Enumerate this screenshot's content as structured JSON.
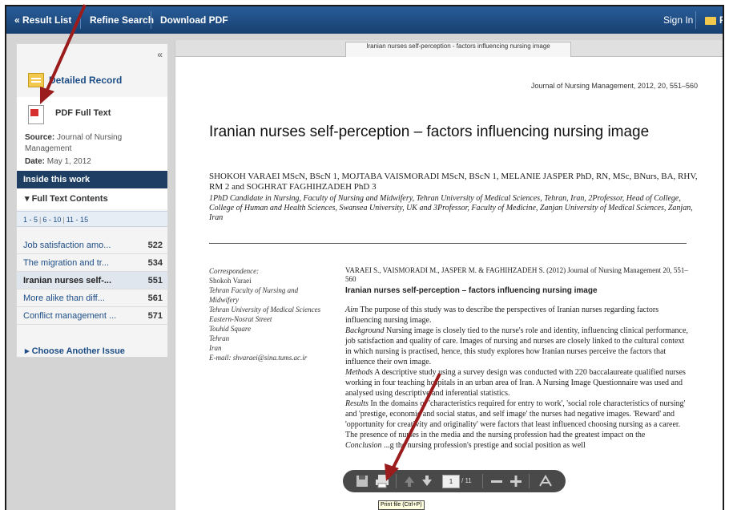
{
  "topbar": {
    "result_list": "« Result List",
    "refine_search": "Refine Search",
    "download_pdf": "Download PDF",
    "sign_in": "Sign In",
    "folder": "Fo"
  },
  "sidebar": {
    "collapse": "«",
    "detailed_record": "Detailed Record",
    "pdf_full_text": "PDF Full Text",
    "source_label": "Source:",
    "source_value": "Journal of Nursing Management",
    "date_label": "Date:",
    "date_value": "May 1, 2012",
    "inside_this_work": "Inside this work",
    "full_text_contents": "Full Text Contents",
    "pages": [
      "1 - 5",
      "6 - 10",
      "11 - 15"
    ],
    "toc": [
      {
        "title": "Job satisfaction amo...",
        "page": "522",
        "active": false
      },
      {
        "title": "The migration and tr...",
        "page": "534",
        "active": false
      },
      {
        "title": "Iranian nurses self-...",
        "page": "551",
        "active": true
      },
      {
        "title": "More alike than diff...",
        "page": "561",
        "active": false
      },
      {
        "title": "Conflict management ...",
        "page": "571",
        "active": false
      }
    ],
    "choose_another": "Choose Another Issue"
  },
  "document": {
    "tab_title": "Iranian nurses self-perception - factors influencing nursing image",
    "journal_ref": "Journal of Nursing Management, 2012, 20, 551–560",
    "title": "Iranian nurses self-perception – factors influencing nursing image",
    "authors": "SHOKOH VARAEI MScN, BScN 1, MOJTABA VAISMORADI MScN, BScN 1, MELANIE JASPER PhD, RN, MSc, BNurs, BA, RHV, RM 2 and SOGHRAT FAGHIHZADEH PhD 3",
    "affiliations": "1PhD Candidate in Nursing, Faculty of Nursing and Midwifery, Tehran University of Medical Sciences, Tehran, Iran, 2Professor, Head of College, College of Human and Health Sciences, Swansea University, UK and 3Professor, Faculty of Medicine, Zanjan University of Medical Sciences, Zanjan, Iran",
    "correspondence": [
      "Correspondence:",
      "Shokoh Varaei",
      "Tehran Faculty of Nursing and Midwifery",
      "Tehran University of Medical Sciences",
      "Eastern-Nosrat Street",
      "Touhid Square",
      "Tehran",
      "Iran",
      "E-mail: shvaraei@sina.tums.ac.ir"
    ],
    "citation": "VARAEI S., VAISMORADI M., JASPER M. & FAGHIHZADEH S. (2012) Journal of Nursing Management 20, 551–560",
    "citation_title": "Iranian nurses self-perception – factors influencing nursing image",
    "abstract": [
      {
        "label": "Aim",
        "text": " The purpose of this study was to describe the perspectives of Iranian nurses regarding factors influencing nursing image."
      },
      {
        "label": "Background",
        "text": " Nursing image is closely tied to the nurse's role and identity, influencing clinical performance, job satisfaction and quality of care. Images of nursing and nurses are closely linked to the cultural context in which nursing is practised, hence, this study explores how Iranian nurses perceive the factors that influence their own image."
      },
      {
        "label": "Methods",
        "text": " A descriptive study using a survey design was conducted with 220 baccalaureate qualified nurses working in four teaching hospitals in an urban area of Iran. A Nursing Image Questionnaire was used and analysed using descriptive and inferential statistics."
      },
      {
        "label": "Results",
        "text": " In the domains of 'characteristics required for entry to work', 'social role characteristics of nursing' and 'prestige, economic and social status, and self image' the nurses had negative images. 'Reward' and 'opportunity for creativity and originality' were factors that least influenced choosing nursing as a career. The presence of nurses in the media and the nursing profession had the greatest impact on the"
      },
      {
        "label": "Conclusion",
        "text": " ...g the nursing profession's prestige and social position as well"
      }
    ]
  },
  "pdf_toolbar": {
    "page_current": "1",
    "page_total": "/ 11",
    "tooltip": "Print file (Ctrl+P)"
  }
}
